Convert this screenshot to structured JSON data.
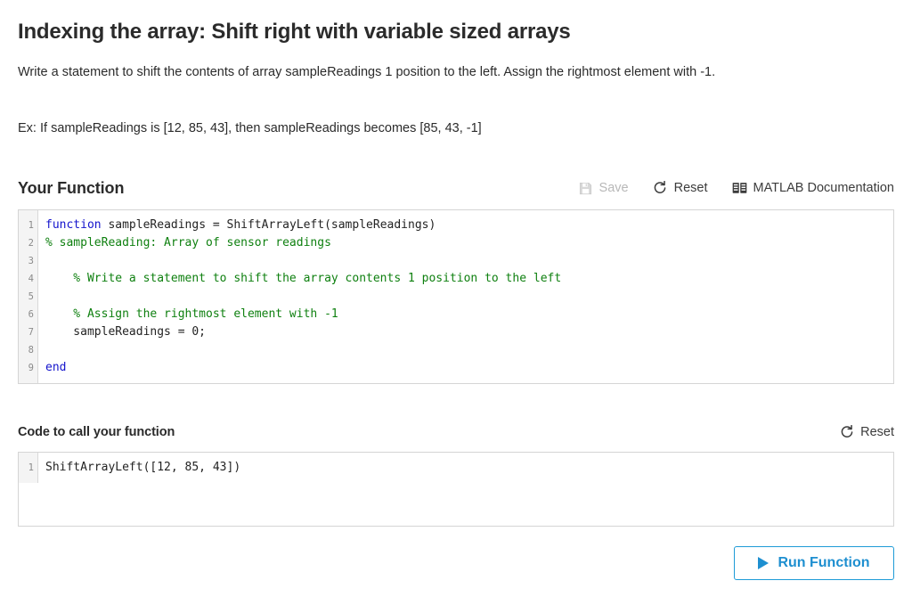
{
  "exercise": {
    "title": "Indexing the array: Shift right with variable sized arrays",
    "description": "Write a statement to shift the contents of array sampleReadings 1 position to the left.  Assign the rightmost element with -1.",
    "example": "Ex: If sampleReadings is [12, 85, 43], then sampleReadings becomes [85, 43, -1]"
  },
  "your_function": {
    "heading": "Your Function",
    "toolbar": {
      "save_label": "Save",
      "save_icon": "floppy-disk-icon",
      "save_disabled": true,
      "reset_label": "Reset",
      "reset_icon": "refresh-circular-arrow-icon",
      "docs_label": "MATLAB Documentation",
      "docs_icon": "book-icon"
    },
    "editor": {
      "line_numbers": [
        "1",
        "2",
        "3",
        "4",
        "5",
        "6",
        "7",
        "8",
        "9"
      ],
      "lines": [
        {
          "kw": "function",
          "rest": " sampleReadings = ShiftArrayLeft(sampleReadings)"
        },
        {
          "comment": "% sampleReading: Array of sensor readings"
        },
        {
          "plain": ""
        },
        {
          "comment": "    % Write a statement to shift the array contents 1 position to the left"
        },
        {
          "plain": ""
        },
        {
          "comment": "    % Assign the rightmost element with -1"
        },
        {
          "plain": "    sampleReadings = 0;"
        },
        {
          "plain": ""
        },
        {
          "kw": "end",
          "rest": ""
        }
      ]
    }
  },
  "call_function": {
    "heading": "Code to call your function",
    "toolbar": {
      "reset_label": "Reset",
      "reset_icon": "refresh-circular-arrow-icon"
    },
    "editor": {
      "line_numbers": [
        "1"
      ],
      "lines": [
        {
          "plain": "ShiftArrayLeft([12, 85, 43])"
        }
      ]
    }
  },
  "run": {
    "label": "Run Function",
    "icon": "play-triangle-icon"
  },
  "colors": {
    "accent_blue": "#1e8fd0",
    "keyword_blue": "#1414cc",
    "comment_green": "#0f8010",
    "disabled_gray": "#b8b8b8",
    "border_gray": "#d5d5d5",
    "gutter_bg": "#f4f4f4"
  }
}
